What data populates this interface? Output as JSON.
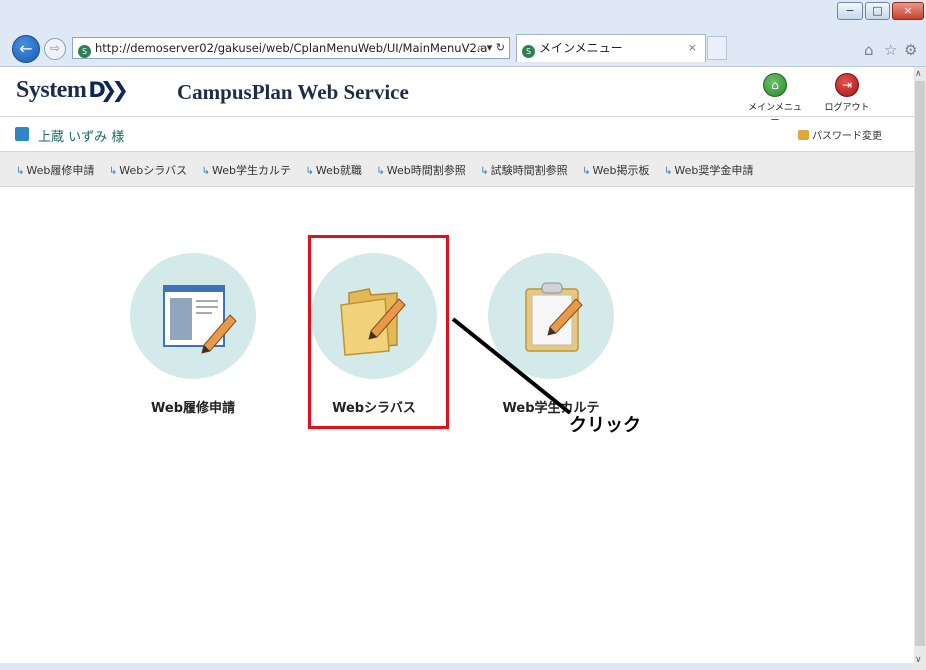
{
  "browser": {
    "url": "http://demoserver02/gakusei/web/CplanMenuWeb/UI/MainMenuV2.a",
    "address_controls": "⌕ ▾ ↻",
    "tab_title": "メインメニュー",
    "tab_close": "×",
    "window_controls": {
      "minimize": "−",
      "maximize": "□",
      "close": "×"
    }
  },
  "header": {
    "logo_text": "System",
    "logo_mark": "D❯❯",
    "service_name": "CampusPlan Web Service",
    "main_menu_label": "メインメニュー",
    "logout_label": "ログアウト"
  },
  "user": {
    "name": "上蔵 いずみ 様",
    "password_change": "パスワード変更"
  },
  "menu": [
    "Web履修申請",
    "Webシラバス",
    "Web学生カルテ",
    "Web就職",
    "Web時間割参照",
    "試験時間割参照",
    "Web掲示板",
    "Web奨学金申請"
  ],
  "apps": [
    {
      "label": "Web履修申請",
      "icon": "document-edit-icon"
    },
    {
      "label": "Webシラバス",
      "icon": "folder-edit-icon"
    },
    {
      "label": "Web学生カルテ",
      "icon": "clipboard-edit-icon"
    }
  ],
  "annotation": {
    "text": "クリック",
    "highlight_color": "#e1101a"
  },
  "colors": {
    "app_circle": "#d4e9e9",
    "menubar": "#ececec",
    "user_name": "#1a6b6b"
  }
}
